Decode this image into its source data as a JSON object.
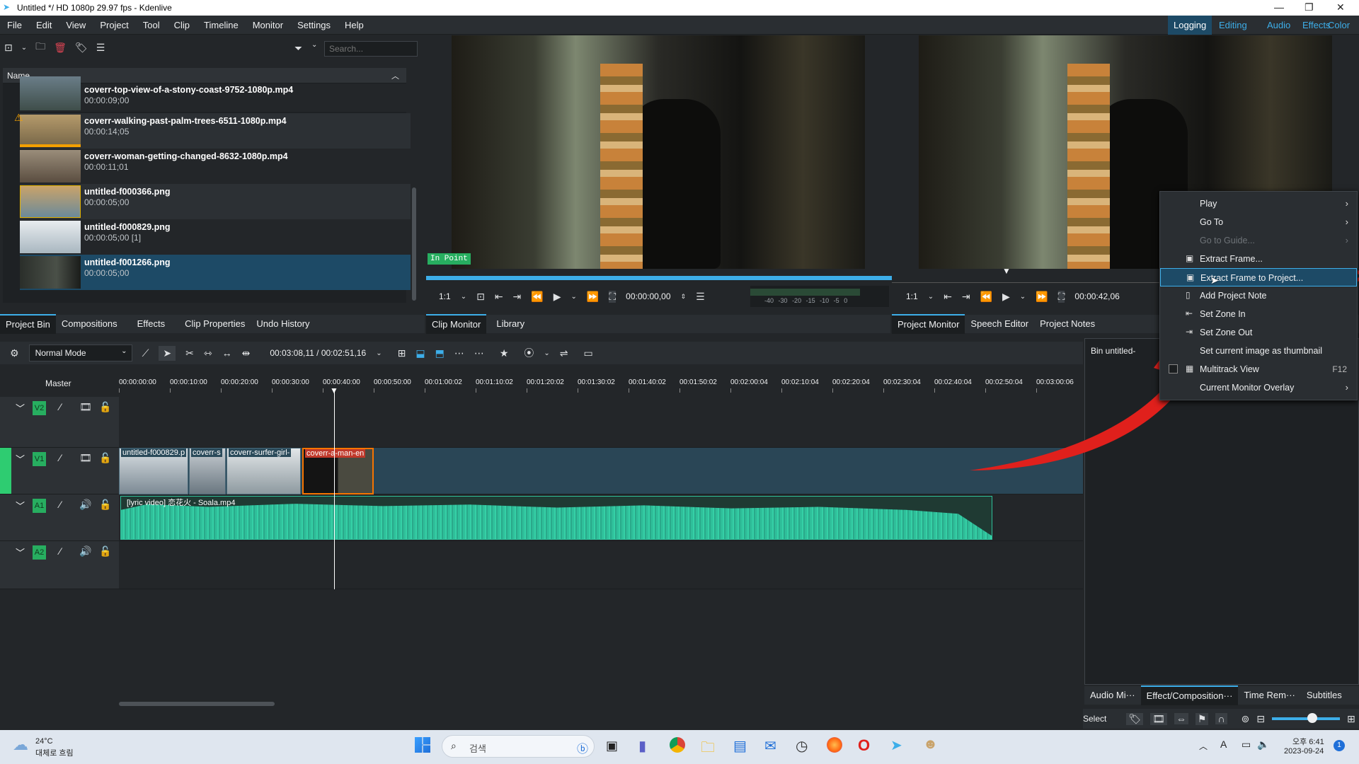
{
  "window": {
    "title": "Untitled */ HD 1080p 29.97 fps - Kdenlive"
  },
  "menu": [
    "File",
    "Edit",
    "View",
    "Project",
    "Tool",
    "Clip",
    "Timeline",
    "Monitor",
    "Settings",
    "Help"
  ],
  "workspaces": [
    "Logging",
    "Editing",
    "Audio",
    "Effects",
    "Color"
  ],
  "bin": {
    "search_placeholder": "Search...",
    "column_name": "Name",
    "items": [
      {
        "name": "coverr-top-view-of-a-stony-coast-9752-1080p.mp4",
        "duration": "00:00:09;00"
      },
      {
        "name": "coverr-walking-past-palm-trees-6511-1080p.mp4",
        "duration": "00:00:14;05"
      },
      {
        "name": "coverr-woman-getting-changed-8632-1080p.mp4",
        "duration": "00:00:11;01"
      },
      {
        "name": "untitled-f000366.png",
        "duration": "00:00:05;00"
      },
      {
        "name": "untitled-f000829.png",
        "duration": "00:00:05;00 [1]"
      },
      {
        "name": "untitled-f001266.png",
        "duration": "00:00:05;00"
      }
    ],
    "tabs": [
      "Project Bin",
      "Compositions",
      "Effects",
      "Clip Properties",
      "Undo History"
    ]
  },
  "clip_monitor": {
    "in_point": "In Point",
    "zoom": "1:1",
    "timecode": "00:00:00,00",
    "meter_labels": [
      "-40",
      "-30",
      "-20",
      "-15",
      "-10",
      "-5",
      "0"
    ],
    "tabs": [
      "Clip Monitor",
      "Library"
    ]
  },
  "project_monitor": {
    "zoom": "1:1",
    "timecode": "00:00:42,06",
    "tabs": [
      "Project Monitor",
      "Speech Editor",
      "Project Notes"
    ]
  },
  "timeline": {
    "mode": "Normal Mode",
    "position": "00:03:08,11 / 00:02:51,16",
    "master": "Master",
    "ruler": [
      "00:00:00:00",
      "00:00:10:00",
      "00:00:20:00",
      "00:00:30:00",
      "00:00:40:00",
      "00:00:50:00",
      "00:01:00:02",
      "00:01:10:02",
      "00:01:20:02",
      "00:01:30:02",
      "00:01:40:02",
      "00:01:50:02",
      "00:02:00:04",
      "00:02:10:04",
      "00:02:20:04",
      "00:02:30:04",
      "00:02:40:04",
      "00:02:50:04",
      "00:03:00:06"
    ],
    "tracks": [
      "V2",
      "V1",
      "A1",
      "A2"
    ],
    "clips": [
      "untitled-f000829.p",
      "coverr-s",
      "coverr-surfer-girl-",
      "coverr-a-man-en"
    ],
    "audio_clip": "[lyric video] 恋花火 - Soala.mp4"
  },
  "right_panel": {
    "bin_label": "Bin untitled-",
    "tabs": [
      "Audio Mi···",
      "Effect/Composition···",
      "Time Rem···",
      "Subtitles"
    ],
    "select_label": "Select"
  },
  "context_menu": {
    "items": [
      {
        "label": "Play",
        "submenu": true
      },
      {
        "label": "Go To",
        "submenu": true
      },
      {
        "label": "Go to Guide...",
        "submenu": true,
        "disabled": true
      },
      {
        "label": "Extract Frame..."
      },
      {
        "label": "Extract Frame to Project...",
        "highlighted": true
      },
      {
        "label": "Add Project Note"
      },
      {
        "label": "Set Zone In"
      },
      {
        "label": "Set Zone Out"
      },
      {
        "label": "Set current image as thumbnail"
      },
      {
        "label": "Multitrack View",
        "shortcut": "F12",
        "checkbox": true
      },
      {
        "label": "Current Monitor Overlay",
        "submenu": true
      }
    ]
  },
  "taskbar": {
    "weather_temp": "24°C",
    "weather_text": "대체로 흐림",
    "search": "검색",
    "time": "오후 6:41",
    "date": "2023-09-24",
    "notif_count": "1"
  },
  "colors": {
    "accent": "#3daee9",
    "track_green": "#27ae60",
    "audio_wave": "#2fbf9a",
    "annotation_red": "#e0201c"
  }
}
